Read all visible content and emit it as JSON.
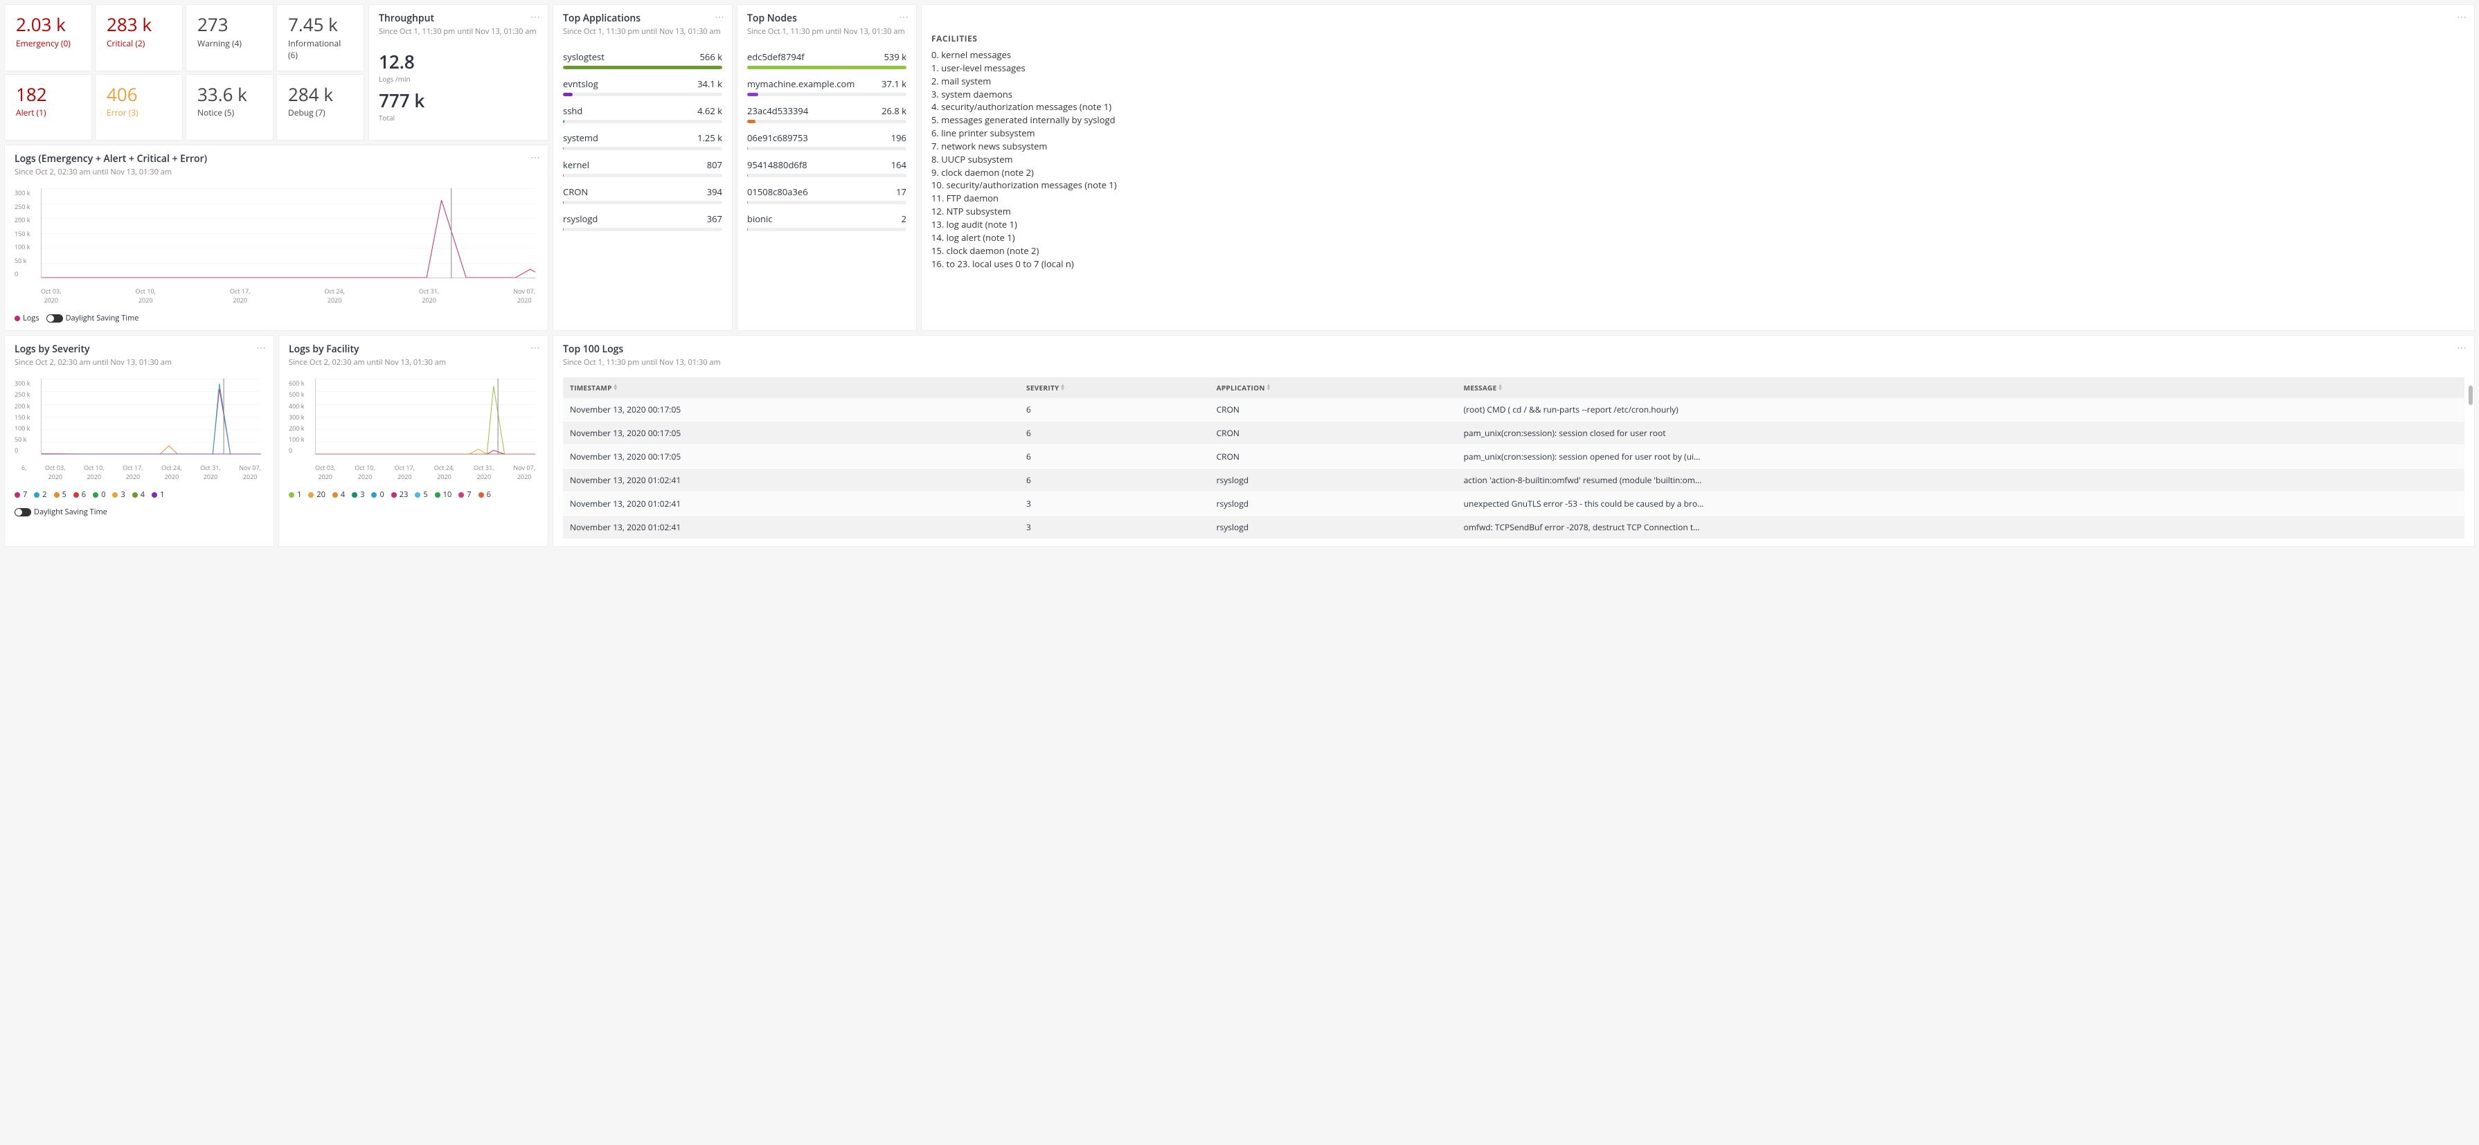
{
  "stats": [
    {
      "value": "2.03 k",
      "label": "Emergency (0)",
      "color": "c-red"
    },
    {
      "value": "283 k",
      "label": "Critical (2)",
      "color": "c-red"
    },
    {
      "value": "273",
      "label": "Warning (4)",
      "color": "c-dark"
    },
    {
      "value": "7.45 k",
      "label": "Informational (6)",
      "color": "c-dark"
    },
    {
      "value": "182",
      "label": "Alert (1)",
      "color": "c-red"
    },
    {
      "value": "406",
      "label": "Error (3)",
      "color": "c-yellow"
    },
    {
      "value": "33.6 k",
      "label": "Notice (5)",
      "color": "c-dark"
    },
    {
      "value": "284 k",
      "label": "Debug (7)",
      "color": "c-dark"
    }
  ],
  "throughput": {
    "title": "Throughput",
    "subtitle": "Since Oct 1, 11:30 pm until Nov 13, 01:30 am",
    "rate": "12.8",
    "rate_label": "Logs /min",
    "total": "777 k",
    "total_label": "Total"
  },
  "top_apps": {
    "title": "Top Applications",
    "subtitle": "Since Oct 1, 11:30 pm until Nov 13, 01:30 am",
    "items": [
      {
        "name": "syslogtest",
        "value": "566 k",
        "pct": 100,
        "color": "#6a9a2d"
      },
      {
        "name": "evntslog",
        "value": "34.1 k",
        "pct": 6,
        "color": "#7b2db8"
      },
      {
        "name": "sshd",
        "value": "4.62 k",
        "pct": 1,
        "color": "#2aa34a"
      },
      {
        "name": "systemd",
        "value": "1.25 k",
        "pct": 0.5,
        "color": "#2a77d4"
      },
      {
        "name": "kernel",
        "value": "807",
        "pct": 0.4,
        "color": "#d43a3a"
      },
      {
        "name": "CRON",
        "value": "394",
        "pct": 0.3,
        "color": "#3b5bd4"
      },
      {
        "name": "rsyslogd",
        "value": "367",
        "pct": 0.3,
        "color": "#d45a2a"
      }
    ]
  },
  "top_nodes": {
    "title": "Top Nodes",
    "subtitle": "Since Oct 1, 11:30 pm until Nov 13, 01:30 am",
    "items": [
      {
        "name": "edc5def8794f",
        "value": "539 k",
        "pct": 100,
        "color": "#8fc43f"
      },
      {
        "name": "mymachine.example.com",
        "value": "37.1 k",
        "pct": 7,
        "color": "#8a3dd4"
      },
      {
        "name": "23ac4d533394",
        "value": "26.8 k",
        "pct": 5,
        "color": "#e07030"
      },
      {
        "name": "06e91c689753",
        "value": "196",
        "pct": 0.2,
        "color": "#888"
      },
      {
        "name": "95414880d6f8",
        "value": "164",
        "pct": 0.2,
        "color": "#888"
      },
      {
        "name": "01508c80a3e6",
        "value": "17",
        "pct": 0.1,
        "color": "#888"
      },
      {
        "name": "bionic",
        "value": "2",
        "pct": 0.1,
        "color": "#888"
      }
    ]
  },
  "facilities": {
    "heading": "FACILITIES",
    "items": [
      "0. kernel messages",
      "1. user-level messages",
      "2. mail system",
      "3. system daemons",
      "4. security/authorization messages (note 1)",
      "5. messages generated internally by syslogd",
      "6. line printer subsystem",
      "7. network news subsystem",
      "8. UUCP subsystem",
      "9. clock daemon (note 2)",
      "10. security/authorization messages (note 1)",
      "11. FTP daemon",
      "12. NTP subsystem",
      "13. log audit (note 1)",
      "14. log alert (note 1)",
      "15. clock daemon (note 2)",
      "16. to 23. local uses 0 to 7 (local n)"
    ]
  },
  "logs_chart": {
    "title": "Logs (Emergency + Alert + Critical + Error)",
    "subtitle": "Since Oct 2, 02:30 am until Nov 13, 01:30 am",
    "legend_label": "Logs",
    "dst_label": "Daylight Saving Time"
  },
  "severity_chart": {
    "title": "Logs by Severity",
    "subtitle": "Since Oct 2, 02:30 am until Nov 13, 01:30 am",
    "dst_label": "Daylight Saving Time",
    "legend": [
      "7",
      "2",
      "5",
      "6",
      "0",
      "3",
      "4",
      "1"
    ]
  },
  "facility_chart": {
    "title": "Logs by Facility",
    "subtitle": "Since Oct 2, 02:30 am until Nov 13, 01:30 am",
    "legend": [
      "1",
      "20",
      "4",
      "3",
      "0",
      "23",
      "5",
      "10",
      "7",
      "6"
    ]
  },
  "top100": {
    "title": "Top 100 Logs",
    "subtitle": "Since Oct 1, 11:30 pm until Nov 13, 01:30 am",
    "headers": {
      "ts": "TIMESTAMP",
      "sev": "SEVERITY",
      "app": "APPLICATION",
      "msg": "MESSAGE"
    },
    "rows": [
      {
        "ts": "November 13, 2020 00:17:05",
        "sev": "6",
        "app": "CRON",
        "msg": "(root) CMD ( cd / && run-parts --report /etc/cron.hourly)"
      },
      {
        "ts": "November 13, 2020 00:17:05",
        "sev": "6",
        "app": "CRON",
        "msg": "pam_unix(cron:session): session closed for user root"
      },
      {
        "ts": "November 13, 2020 00:17:05",
        "sev": "6",
        "app": "CRON",
        "msg": "pam_unix(cron:session): session opened for user root by (ui…"
      },
      {
        "ts": "November 13, 2020 01:02:41",
        "sev": "6",
        "app": "rsyslogd",
        "msg": "action 'action-8-builtin:omfwd' resumed (module 'builtin:om…"
      },
      {
        "ts": "November 13, 2020 01:02:41",
        "sev": "3",
        "app": "rsyslogd",
        "msg": "unexpected GnuTLS error -53 - this could be caused by a bro…"
      },
      {
        "ts": "November 13, 2020 01:02:41",
        "sev": "3",
        "app": "rsyslogd",
        "msg": "omfwd: TCPSendBuf error -2078, destruct TCP Connection t…"
      }
    ]
  },
  "chart_data": [
    {
      "id": "logs_chart",
      "type": "line",
      "title": "Logs (Emergency + Alert + Critical + Error)",
      "x_ticks": [
        "Oct 03, 2020",
        "Oct 10, 2020",
        "Oct 17, 2020",
        "Oct 24, 2020",
        "Oct 31, 2020",
        "Nov 07, 2020"
      ],
      "x_idx": [
        0,
        1,
        2,
        3,
        4,
        5
      ],
      "ylim": [
        0,
        300000
      ],
      "y_ticks": [
        0,
        50000,
        100000,
        150000,
        200000,
        250000,
        300000
      ],
      "y_tick_labels": [
        "0",
        "50 k",
        "100 k",
        "150 k",
        "200 k",
        "250 k",
        "300 k"
      ],
      "series": [
        {
          "name": "Logs",
          "color": "#c62874",
          "x": [
            0,
            1,
            2,
            3,
            3.9,
            4.05,
            4.3,
            4.8,
            4.95,
            5.1,
            5.4
          ],
          "y": [
            0,
            0,
            0,
            0,
            0,
            260000,
            0,
            0,
            28000,
            0,
            0
          ]
        }
      ],
      "annotations": {
        "cursor_x": 4.15
      }
    },
    {
      "id": "severity_chart",
      "type": "line",
      "title": "Logs by Severity",
      "x_ticks": [
        "Oct 03, 2020",
        "Oct 10, 2020",
        "Oct 17, 2020",
        "Oct 24, 2020",
        "Oct 31, 2020",
        "Nov 07, 2020"
      ],
      "x_idx": [
        0,
        1,
        2,
        3,
        4,
        5
      ],
      "ylim": [
        0,
        300000
      ],
      "y_ticks": [
        0,
        50000,
        100000,
        150000,
        200000,
        250000,
        300000
      ],
      "y_tick_labels": [
        "0",
        "50 k",
        "100 k",
        "150 k",
        "200 k",
        "250 k",
        "300 k"
      ],
      "x_prefix": "6,",
      "series": [
        {
          "name": "7",
          "color": "#c62874",
          "x": [
            0,
            1,
            2,
            3,
            3.9,
            4.05,
            4.3,
            5
          ],
          "y": [
            1000,
            0,
            0,
            0,
            0,
            260000,
            0,
            0
          ]
        },
        {
          "name": "2",
          "color": "#2aa0d4",
          "x": [
            0,
            1,
            2,
            3,
            3.9,
            4.05,
            4.3,
            5
          ],
          "y": [
            0,
            0,
            0,
            0,
            0,
            280000,
            0,
            0
          ]
        },
        {
          "name": "5",
          "color": "#e88a2a",
          "x": [
            0,
            1,
            2,
            2.7,
            2.9,
            3.1,
            3.9,
            5
          ],
          "y": [
            0,
            0,
            0,
            0,
            33000,
            0,
            0,
            0
          ]
        },
        {
          "name": "6",
          "color": "#d43a3a",
          "x": [
            0,
            5
          ],
          "y": [
            0,
            0
          ]
        },
        {
          "name": "0",
          "color": "#2aa34a",
          "x": [
            0,
            5
          ],
          "y": [
            0,
            0
          ]
        },
        {
          "name": "3",
          "color": "#e8a33d",
          "x": [
            0,
            5
          ],
          "y": [
            0,
            0
          ]
        },
        {
          "name": "4",
          "color": "#6a9a2d",
          "x": [
            0,
            5
          ],
          "y": [
            0,
            0
          ]
        },
        {
          "name": "1",
          "color": "#7b2db8",
          "x": [
            0,
            5
          ],
          "y": [
            0,
            0
          ]
        }
      ],
      "annotations": {
        "cursor_x": 4.15
      }
    },
    {
      "id": "facility_chart",
      "type": "line",
      "title": "Logs by Facility",
      "x_ticks": [
        "Oct 03, 2020",
        "Oct 10, 2020",
        "Oct 17, 2020",
        "Oct 24, 2020",
        "Oct 31, 2020",
        "Nov 07, 2020"
      ],
      "x_idx": [
        0,
        1,
        2,
        3,
        4,
        5
      ],
      "ylim": [
        0,
        600000
      ],
      "y_ticks": [
        0,
        100000,
        200000,
        300000,
        400000,
        500000,
        600000
      ],
      "y_tick_labels": [
        "0",
        "100 k",
        "200 k",
        "300 k",
        "400 k",
        "500 k",
        "600 k"
      ],
      "series": [
        {
          "name": "1",
          "color": "#8fc43f",
          "x": [
            0,
            1,
            2,
            3,
            3.9,
            4.05,
            4.3,
            5
          ],
          "y": [
            0,
            0,
            0,
            0,
            0,
            540000,
            0,
            0
          ]
        },
        {
          "name": "20",
          "color": "#e8a33d",
          "x": [
            0,
            1,
            2,
            3,
            3.5,
            3.7,
            3.9,
            5
          ],
          "y": [
            0,
            0,
            0,
            0,
            0,
            40000,
            0,
            0
          ]
        },
        {
          "name": "4",
          "color": "#e88a2a",
          "x": [
            0,
            5
          ],
          "y": [
            0,
            0
          ]
        },
        {
          "name": "3",
          "color": "#1a8a70",
          "x": [
            0,
            5
          ],
          "y": [
            0,
            0
          ]
        },
        {
          "name": "0",
          "color": "#2aa0d4",
          "x": [
            0,
            5
          ],
          "y": [
            0,
            0
          ]
        },
        {
          "name": "23",
          "color": "#c62874",
          "x": [
            0,
            1,
            2,
            3,
            3.9,
            4.05,
            4.3,
            5
          ],
          "y": [
            0,
            0,
            0,
            0,
            0,
            30000,
            0,
            0
          ]
        },
        {
          "name": "5",
          "color": "#4fb8e0",
          "x": [
            0,
            5
          ],
          "y": [
            0,
            0
          ]
        },
        {
          "name": "10",
          "color": "#2aa34a",
          "x": [
            0,
            5
          ],
          "y": [
            0,
            0
          ]
        },
        {
          "name": "7",
          "color": "#d43a7a",
          "x": [
            0,
            5
          ],
          "y": [
            0,
            0
          ]
        },
        {
          "name": "6",
          "color": "#e06030",
          "x": [
            0,
            5
          ],
          "y": [
            0,
            0
          ]
        }
      ],
      "annotations": {
        "cursor_x": 4.15
      }
    }
  ],
  "legend_colors": {
    "severity": [
      "#c62874",
      "#2aa0d4",
      "#e88a2a",
      "#d43a3a",
      "#2aa34a",
      "#e8a33d",
      "#6a9a2d",
      "#7b2db8"
    ],
    "facility": [
      "#8fc43f",
      "#e8a33d",
      "#e88a2a",
      "#1a8a70",
      "#2aa0d4",
      "#c62874",
      "#4fb8e0",
      "#2aa34a",
      "#d43a7a",
      "#e06030"
    ]
  }
}
